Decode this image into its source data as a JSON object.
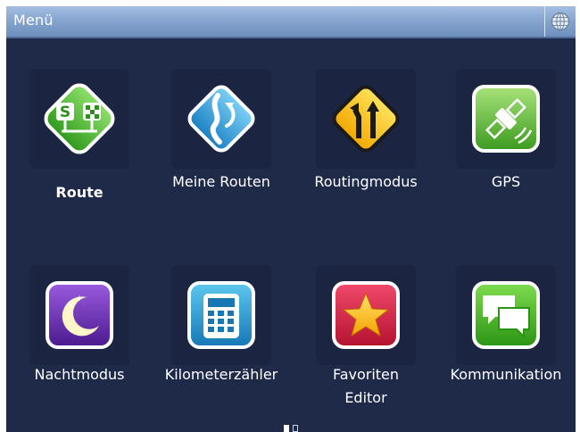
{
  "header": {
    "title": "Menü",
    "globe_icon": "globe-icon"
  },
  "tiles": [
    {
      "label": "Route",
      "icon": "route-icon",
      "bold": true
    },
    {
      "label": "Meine Routen",
      "icon": "my-routes-icon"
    },
    {
      "label": "Routingmodus",
      "icon": "routing-mode-icon"
    },
    {
      "label": "GPS",
      "icon": "gps-icon"
    },
    {
      "label": "Nachtmodus",
      "icon": "night-mode-icon"
    },
    {
      "label": "Kilometerzähler",
      "icon": "odometer-icon"
    },
    {
      "label_line1": "Favoriten",
      "label_line2": "Editor",
      "icon": "favorites-icon"
    },
    {
      "label": "Kommunikation",
      "icon": "communication-icon"
    }
  ],
  "pager": {
    "current": 1,
    "total": 2
  }
}
